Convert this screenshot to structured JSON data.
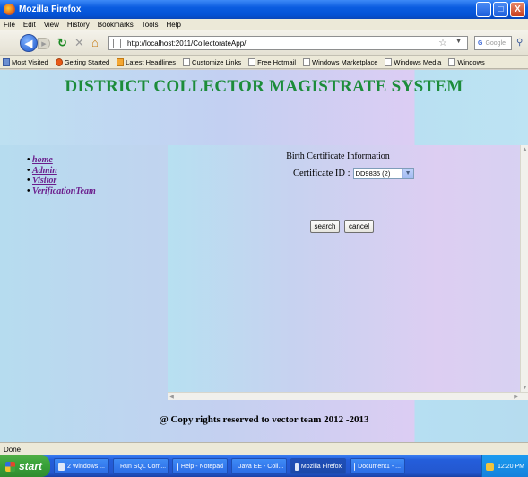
{
  "window": {
    "title": "Mozilla Firefox",
    "min_glyph": "_",
    "max_glyph": "□",
    "close_glyph": "X"
  },
  "menu": [
    "File",
    "Edit",
    "View",
    "History",
    "Bookmarks",
    "Tools",
    "Help"
  ],
  "toolbar": {
    "url": "http://localhost:2011/CollectorateApp/",
    "search_placeholder": "Google",
    "search_engine": "G"
  },
  "bookmarks": [
    "Most Visited",
    "Getting Started",
    "Latest Headlines",
    "Customize Links",
    "Free Hotmail",
    "Windows Marketplace",
    "Windows Media",
    "Windows"
  ],
  "page": {
    "title": "DISTRICT COLLECTOR MAGISTRATE SYSTEM",
    "nav": [
      "home",
      "Admin",
      "Visitor",
      "VerificationTeam"
    ],
    "heading": "Birth Certificate Information",
    "cert_label": "Certificate ID :",
    "cert_value": "DD9835 (2)",
    "search_label": "search",
    "cancel_label": "cancel",
    "footer": "@ Copy rights reserved to vector team 2012 -2013"
  },
  "status": "Done",
  "taskbar": {
    "start": "start",
    "tasks": [
      "2 Windows ...",
      "Run SQL Com...",
      "Help - Notepad",
      "Java EE - Coll...",
      "Mozilla Firefox",
      "Document1 - ..."
    ],
    "time": "12:20 PM"
  },
  "colors": {
    "title_green": "#1c8c3a",
    "nav_link": "#6b1d8c"
  }
}
